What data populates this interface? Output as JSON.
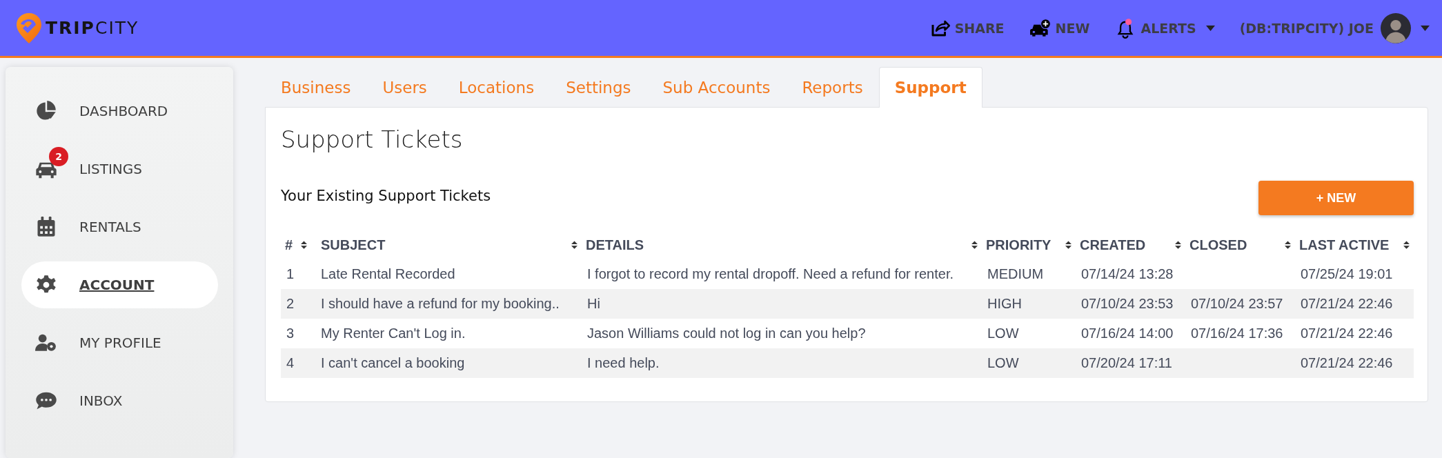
{
  "header": {
    "logo": {
      "bold": "TRIP",
      "light": "CITY"
    },
    "actions": [
      {
        "kind": "share",
        "label": "SHARE"
      },
      {
        "kind": "new",
        "label": "NEW"
      },
      {
        "kind": "alerts",
        "label": "ALERTS",
        "dropdown": true
      }
    ],
    "user": {
      "name": "(DB:TRIPCITY) JOE",
      "dropdown": true
    }
  },
  "sidebar": {
    "items": [
      {
        "kind": "dashboard",
        "label": "DASHBOARD",
        "selected": false
      },
      {
        "kind": "listings",
        "label": "LISTINGS",
        "badge": "2",
        "selected": false
      },
      {
        "kind": "rentals",
        "label": "RENTALS",
        "selected": false
      },
      {
        "kind": "account",
        "label": "ACCOUNT",
        "selected": true
      },
      {
        "kind": "profile",
        "label": "MY PROFILE",
        "selected": false
      },
      {
        "kind": "inbox",
        "label": "INBOX",
        "selected": false
      }
    ]
  },
  "tabs": [
    {
      "label": "Business",
      "selected": false
    },
    {
      "label": "Users",
      "selected": false
    },
    {
      "label": "Locations",
      "selected": false
    },
    {
      "label": "Settings",
      "selected": false
    },
    {
      "label": "Sub Accounts",
      "selected": false
    },
    {
      "label": "Reports",
      "selected": false
    },
    {
      "label": "Support",
      "selected": true
    }
  ],
  "panel": {
    "title": "Support Tickets",
    "subtitle": "Your Existing Support Tickets",
    "new_button": "+ NEW"
  },
  "table": {
    "columns": [
      "#",
      "SUBJECT",
      "DETAILS",
      "PRIORITY",
      "CREATED",
      "CLOSED",
      "LAST ACTIVE"
    ],
    "rows": [
      [
        "1",
        "Late Rental Recorded",
        "I forgot to record my rental dropoff. Need a refund for renter.",
        "MEDIUM",
        "07/14/24 13:28",
        "",
        "07/25/24 19:01"
      ],
      [
        "2",
        "I should have a refund for my booking..",
        "Hi",
        "HIGH",
        "07/10/24 23:53",
        "07/10/24 23:57",
        "07/21/24 22:46"
      ],
      [
        "3",
        "My Renter Can't Log in.",
        "Jason Williams could not log in can you help?",
        "LOW",
        "07/16/24 14:00",
        "07/16/24 17:36",
        "07/21/24 22:46"
      ],
      [
        "4",
        "I can't cancel a booking",
        "I need help.",
        "LOW",
        "07/20/24 17:11",
        "",
        "07/21/24 22:46"
      ]
    ]
  }
}
